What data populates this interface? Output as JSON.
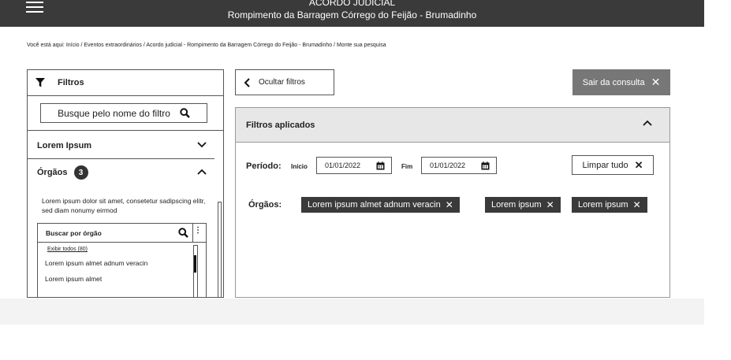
{
  "header": {
    "title": "ACORDO JUDICIAL",
    "subtitle": "Rompimento da Barragem Córrego do Feijão - Brumadinho"
  },
  "breadcrumb": "Você está aqui: Início / Eventos extraordinários / Acordo judicial - Rompimento da Barragem Córrego do Feijão - Brumadinho / Monte sua pesquisa",
  "filters_panel": {
    "title": "Filtros",
    "search_label": "Busque pelo nome do filtro",
    "sections": [
      {
        "label": "Lorem Ipsum",
        "expanded": false
      },
      {
        "label": "Órgãos",
        "count": "3",
        "expanded": true
      }
    ],
    "orgaos_description": "Lorem ipsum dolor sit amet, consetetur sadipscing elitr, sed diam nonumy eirmod",
    "orgaos_search_label": "Buscar por órgão",
    "orgaos_more": "⋮",
    "show_all_link": "Exibir todos (80)",
    "orgaos_items": [
      "Lorem ipsum almet adnum veracin",
      "Lorem ipsum almet"
    ]
  },
  "toolbar": {
    "hide_filters_label": "Ocultar filtros",
    "exit_label": "Sair da consulta",
    "exit_icon": "close-icon"
  },
  "applied": {
    "title": "Filtros aplicados",
    "period_label": "Período:",
    "start_label": "Início",
    "start_value": "01/01/2022",
    "end_label": "Fim",
    "end_value": "01/01/2022",
    "clear_label": "Limpar tudo",
    "orgaos_label": "Órgãos:",
    "chips": [
      "Lorem ipsum almet adnum veracin",
      "Lorem ipsum",
      "Lorem ipsum"
    ]
  },
  "colors": {
    "topbar": "#3a3a3a",
    "chip": "#3a3a3a",
    "exit_button": "#777777",
    "applied_header": "#e7e7e7"
  }
}
